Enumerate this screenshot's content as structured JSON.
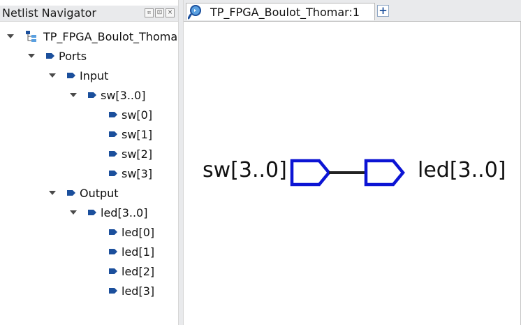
{
  "navigator": {
    "title": "Netlist Navigator",
    "header_buttons": [
      "pin-icon",
      "restore-icon",
      "close-icon"
    ],
    "tree": {
      "root": "TP_FPGA_Boulot_Thomar",
      "ports": "Ports",
      "input": "Input",
      "sw_bus": "sw[3..0]",
      "sw_bits": [
        "sw[0]",
        "sw[1]",
        "sw[2]",
        "sw[3]"
      ],
      "output": "Output",
      "led_bus": "led[3..0]",
      "led_bits": [
        "led[0]",
        "led[1]",
        "led[2]",
        "led[3]"
      ]
    }
  },
  "editor": {
    "tab_label": "TP_FPGA_Boulot_Thomar:1",
    "add_tab_label": "+",
    "tab_icon": "magnifier-icon"
  },
  "schematic": {
    "input_port": "sw[3..0]",
    "output_port": "led[3..0]",
    "port_color": "#0c14d4",
    "wire_color": "#222222"
  }
}
